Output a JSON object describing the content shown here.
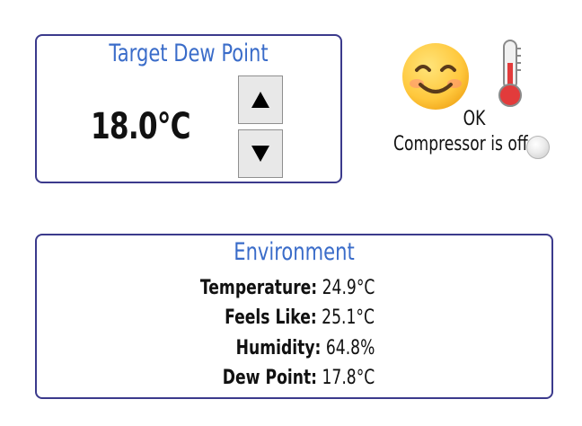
{
  "target": {
    "title": "Target Dew Point",
    "value": "18.0°C",
    "up_label": "▲",
    "down_label": "▼"
  },
  "status": {
    "mood_icon": "smiling-face-icon",
    "temp_icon": "thermometer-icon",
    "text": "OK",
    "compressor_text": "Compressor is off",
    "compressor_indicator": "white-circle-icon"
  },
  "environment": {
    "title": "Environment",
    "rows": [
      {
        "label": "Temperature:",
        "value": "24.9°C"
      },
      {
        "label": "Feels Like:",
        "value": "25.1°C"
      },
      {
        "label": "Humidity:",
        "value": "64.8%"
      },
      {
        "label": "Dew Point:",
        "value": "17.8°C"
      }
    ]
  },
  "colors": {
    "title_blue": "#3a6cc9",
    "card_border": "#3b3a8c"
  }
}
